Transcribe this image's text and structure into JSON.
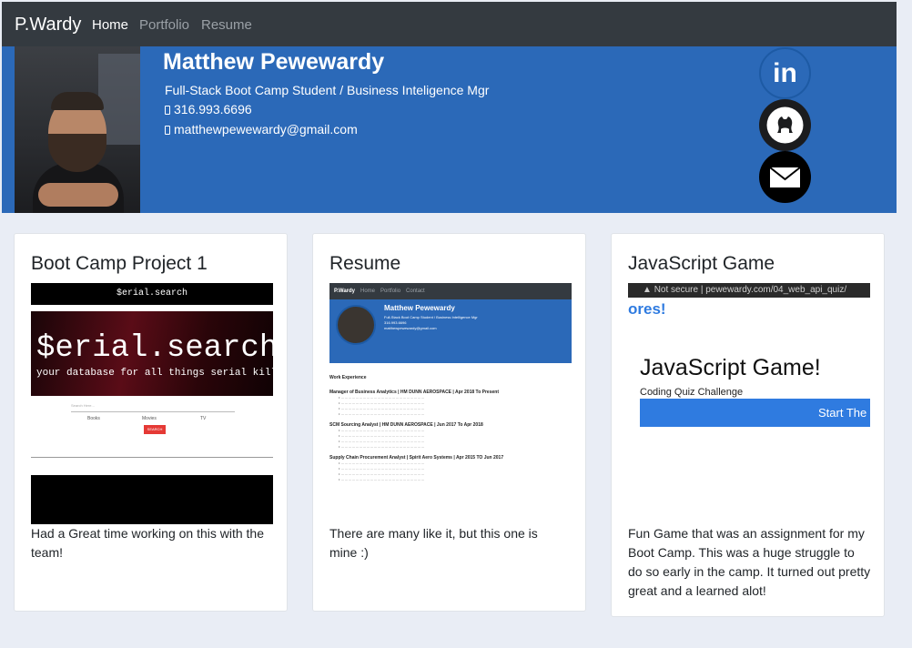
{
  "navbar": {
    "brand": "P.Wardy",
    "links": [
      {
        "label": "Home",
        "active": true
      },
      {
        "label": "Portfolio",
        "active": false
      },
      {
        "label": "Resume",
        "active": false
      }
    ]
  },
  "hero": {
    "name": "Matthew Pewewardy",
    "title": "Full-Stack Boot Camp Student / Business Inteligence Mgr",
    "phone": "316.993.6696",
    "email": "matthewpewewardy@gmail.com",
    "social": [
      {
        "icon": "linkedin-icon",
        "glyph": "in"
      },
      {
        "icon": "github-icon"
      },
      {
        "icon": "mail-icon"
      }
    ]
  },
  "cards": [
    {
      "title": "Boot Camp Project 1",
      "text": "Had a Great time working on this with the team!",
      "thumb": {
        "top_bar": "$erial.search",
        "big": "$erial.search",
        "subtitle": "your database for all things serial killers",
        "search_placeholder": "Search Here...",
        "checks": [
          "Books",
          "Movies",
          "TV"
        ],
        "button": "SEARCH"
      }
    },
    {
      "title": "Resume",
      "text": "There are many like it, but this one is mine :)",
      "thumb": {
        "brand": "P.Wardy",
        "nav": [
          "Home",
          "Portfolio",
          "Contact"
        ],
        "name": "Matthew Pewewardy",
        "subtitle": "Full-Stack Boot Camp Student / Business Intelligence Mgr",
        "phone": "316.993.6696",
        "email": "matthewpewewardy@gmail.com",
        "section": "Work Experience",
        "jobs": [
          "Manager of Business Analytics | HM DUNN AEROSPACE | Apr 2018 To Present",
          "SCM Sourcing Analyst | HM DUNN AEROSPACE | Jun 2017 To Apr 2018",
          "Supply Chain Procurement Analyst | Spirit Aero Systems | Apr 2015 TO Jun 2017"
        ]
      }
    },
    {
      "title": "JavaScript Game",
      "text": "Fun Game that was an assignment for my Boot Camp. This was a huge struggle to do so early in the camp. It turned out pretty great and a learned alot!",
      "thumb": {
        "url_prefix": "Not secure",
        "url": "pewewardy.com/04_web_api_quiz/",
        "partial_heading": "ores!",
        "heading": "JavaScript Game!",
        "subheading": "Coding Quiz Challenge",
        "button": "Start The G"
      }
    }
  ],
  "colors": {
    "navbar": "#343a40",
    "hero": "#2b69b8",
    "page_bg": "#e9edf5",
    "accent_blue": "#2f7be0"
  }
}
